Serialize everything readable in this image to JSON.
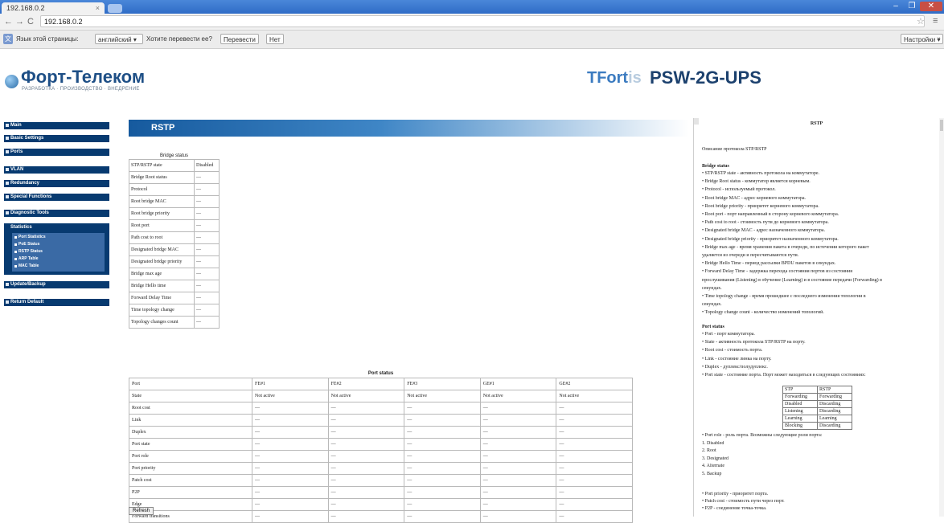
{
  "browser": {
    "tab_title": "192.168.0.2",
    "tab_close": "×",
    "url": "192.168.0.2",
    "win_min": "–",
    "win_max": "❐",
    "win_close": "✕",
    "back": "←",
    "forward": "→",
    "reload": "C",
    "star": "☆",
    "menu": "≡"
  },
  "translate_bar": {
    "icon": "文",
    "text": "Язык этой страницы:",
    "language": "английский ▾",
    "question": "Хотите перевести ее?",
    "translate_button": "Перевести",
    "never_button": "Нет",
    "settings_button": "Настройки ▾",
    "close": "×"
  },
  "header": {
    "brand": "Форт-Телеком",
    "tagline": "РАЗРАБОТКА · ПРОИЗВОДСТВО · ВНЕДРЕНИЕ",
    "logo_t": "T",
    "logo_fort": "Fort",
    "logo_is": "is",
    "model": "PSW-2G-UPS"
  },
  "menu": {
    "items": [
      "Main",
      "Basic Settings",
      "Ports",
      "VLAN",
      "Redundancy",
      "Special Functions",
      "Diagnostic Tools"
    ],
    "statistics": {
      "title": "Statistics",
      "items": [
        "Port Statistics",
        "PoE Status",
        "RSTP Status",
        "ARP Table",
        "MAC Table"
      ]
    },
    "bottom_items": [
      "Update/Backup",
      "Return Default"
    ]
  },
  "main": {
    "section_title": "RSTP",
    "bridge_status": {
      "caption": "Bridge status",
      "rows": [
        [
          "STP/RSTP state",
          "Disabled"
        ],
        [
          "Bridge Root status",
          "—"
        ],
        [
          "Protocol",
          "—"
        ],
        [
          "Root bridge MAC",
          "—"
        ],
        [
          "Root bridge priority",
          "—"
        ],
        [
          "Root port",
          "—"
        ],
        [
          "Path cost to root",
          "—"
        ],
        [
          "Designated bridge MAC",
          "—"
        ],
        [
          "Designated bridge priority",
          "—"
        ],
        [
          "Bridge max age",
          "—"
        ],
        [
          "Bridge Hello time",
          "—"
        ],
        [
          "Forward Delay Time",
          "—"
        ],
        [
          "Time topology change",
          "—"
        ],
        [
          "Topology changes count",
          "—"
        ]
      ]
    },
    "port_status": {
      "caption": "Port status",
      "header": [
        "Port",
        "FE#1",
        "FE#2",
        "FE#3",
        "GE#1",
        "GE#2"
      ],
      "rows": [
        [
          "State",
          "Not active",
          "Not active",
          "Not active",
          "Not active",
          "Not active"
        ],
        [
          "Root cost",
          "—",
          "—",
          "—",
          "—",
          "—"
        ],
        [
          "Link",
          "—",
          "—",
          "—",
          "—",
          "—"
        ],
        [
          "Duplex",
          "—",
          "—",
          "—",
          "—",
          "—"
        ],
        [
          "Port state",
          "—",
          "—",
          "—",
          "—",
          "—"
        ],
        [
          "Port role",
          "—",
          "—",
          "—",
          "—",
          "—"
        ],
        [
          "Port priority",
          "—",
          "—",
          "—",
          "—",
          "—"
        ],
        [
          "Patch cost",
          "—",
          "—",
          "—",
          "—",
          "—"
        ],
        [
          "P2P",
          "—",
          "—",
          "—",
          "—",
          "—"
        ],
        [
          "Edge",
          "—",
          "—",
          "—",
          "—",
          "—"
        ],
        [
          "Forward transitions",
          "—",
          "—",
          "—",
          "—",
          "—"
        ]
      ]
    },
    "refresh_button": "Refresh"
  },
  "help": {
    "title": "RSTP",
    "intro": "Описание протокола STP/RSTP",
    "bridge_heading": "Bridge status",
    "bridge_lines": [
      "• STP/RSTP state - активность протокола на коммутаторе.",
      "• Bridge Root status - коммутатор является корневым.",
      "• Protocol - используемый протокол.",
      "• Root bridge MAC - адрес корневого коммутатора.",
      "• Root bridge priority - приоритет корневого коммутатора.",
      "• Root port - порт направленный в сторону корневого коммутатора.",
      "• Path cost to root - стоимость пути до корневого коммутатора.",
      "• Designated bridge MAC - адрес назначенного коммутатора.",
      "• Designated bridge priority - приоритет назначенного коммутатора.",
      "• Bridge max age - время хранения пакета в очереди, по истечении которого пакет",
      "удаляется из очереди и пересчитываются пути.",
      "• Bridge Hello Time - период рассылки BPDU пакетов в секундах.",
      "• Forward Delay Time - задержка перехода состояния портов из состояния",
      "прослушивания (Listening) в обучение (Learning) и в состояние передачи (Forwarding) в",
      "секундах.",
      "• Time topology change - время прошедшее с последнего изменения топологии в",
      "секундах.",
      "• Topology change count - количество изменений топологий."
    ],
    "port_heading": "Port status",
    "port_lines": [
      "• Port - порт коммутатора.",
      "• State - активность протокола STP/RSTP на порту.",
      "• Root cost - стоимость порта.",
      "• Link - состояние линка на порту.",
      "• Duplex - дуплекс/полудуплекс.",
      "• Port state - состояние порта. Порт может находиться в следующих состояниях:"
    ],
    "state_table": [
      [
        "STP",
        "RSTP"
      ],
      [
        "Forwarding",
        "Forwarding"
      ],
      [
        "Disabled",
        "Discarding"
      ],
      [
        "Listening",
        "Discarding"
      ],
      [
        "Learning",
        "Learning"
      ],
      [
        "Blocking",
        "Discarding"
      ]
    ],
    "role_lines": [
      "• Port role - роль порта. Возможны следующие роли порта:",
      "1. Disabled",
      "2. Root",
      "3. Designated",
      "4. Alternate",
      "5. Backup"
    ],
    "tail_lines": [
      "• Port priority - приоритет порта.",
      "• Patch cost - стоимость пути через порт.",
      "• P2P - соединение точка-точка."
    ]
  }
}
